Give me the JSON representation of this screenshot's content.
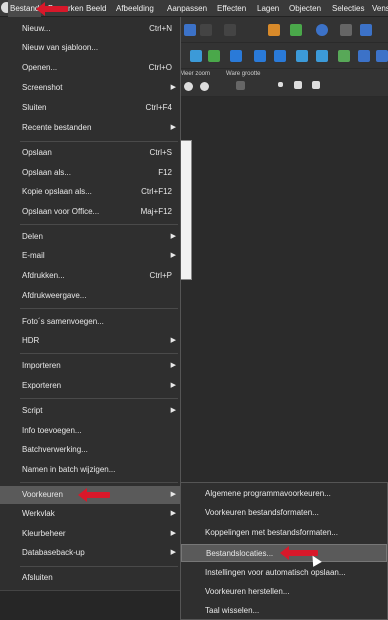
{
  "menubar": {
    "items": [
      "Bestand",
      "Bewerken",
      "Beeld",
      "Afbeelding",
      "Aanpassen",
      "Effecten",
      "Lagen",
      "Objecten",
      "Selecties",
      "Vens"
    ]
  },
  "toolbar": {
    "zoom_label": "Meer zoom",
    "actual_size_label": "Ware grootte"
  },
  "main_menu": {
    "items": [
      {
        "label": "Nieuw...",
        "shortcut": "Ctrl+N"
      },
      {
        "label": "Nieuw van sjabloon...",
        "shortcut": ""
      },
      {
        "label": "Openen...",
        "shortcut": "Ctrl+O"
      },
      {
        "label": "Screenshot",
        "shortcut": "",
        "submenu": "▶"
      },
      {
        "label": "Sluiten",
        "shortcut": "Ctrl+F4"
      },
      {
        "label": "Recente bestanden",
        "shortcut": "",
        "submenu": "▶"
      },
      {
        "label": "Opslaan",
        "shortcut": "Ctrl+S"
      },
      {
        "label": "Opslaan als...",
        "shortcut": "F12"
      },
      {
        "label": "Kopie opslaan als...",
        "shortcut": "Ctrl+F12"
      },
      {
        "label": "Opslaan voor Office...",
        "shortcut": "Maj+F12"
      },
      {
        "label": "Delen",
        "shortcut": "",
        "submenu": "▶"
      },
      {
        "label": "E-mail",
        "shortcut": "",
        "submenu": "▶"
      },
      {
        "label": "Afdrukken...",
        "shortcut": "Ctrl+P"
      },
      {
        "label": "Afdrukweergave...",
        "shortcut": ""
      },
      {
        "label": "Foto´s samenvoegen...",
        "shortcut": ""
      },
      {
        "label": "HDR",
        "shortcut": "",
        "submenu": "▶"
      },
      {
        "label": "Importeren",
        "shortcut": "",
        "submenu": "▶"
      },
      {
        "label": "Exporteren",
        "shortcut": "",
        "submenu": "▶"
      },
      {
        "label": "Script",
        "shortcut": "",
        "submenu": "▶"
      },
      {
        "label": "Info toevoegen...",
        "shortcut": ""
      },
      {
        "label": "Batchverwerking...",
        "shortcut": ""
      },
      {
        "label": "Namen in batch wijzigen...",
        "shortcut": ""
      },
      {
        "label": "Voorkeuren",
        "shortcut": "",
        "submenu": "▶"
      },
      {
        "label": "Werkvlak",
        "shortcut": "",
        "submenu": "▶"
      },
      {
        "label": "Kleurbeheer",
        "shortcut": "",
        "submenu": "▶"
      },
      {
        "label": "Databaseback-up",
        "shortcut": "",
        "submenu": "▶"
      },
      {
        "label": "Afsluiten",
        "shortcut": ""
      }
    ]
  },
  "sub_menu": {
    "items": [
      "Algemene programmavoorkeuren...",
      "Voorkeuren bestandsformaten...",
      "Koppelingen met bestandsformaten...",
      "Bestandslocaties...",
      "Instellingen voor automatisch opslaan...",
      "Voorkeuren herstellen...",
      "Taal wisselen..."
    ]
  },
  "colors": {
    "accent_red": "#d8182a",
    "highlight": "#5a5a5a"
  }
}
